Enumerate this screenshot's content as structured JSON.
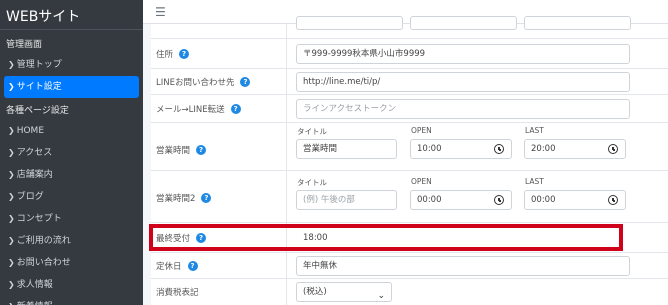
{
  "sidebar": {
    "brand": "WEBサイト",
    "sections": [
      {
        "header": "管理画面",
        "items": [
          {
            "label": "管理トップ",
            "active": false
          },
          {
            "label": "サイト設定",
            "active": true
          }
        ]
      },
      {
        "header": "各種ページ設定",
        "items": [
          {
            "label": "HOME",
            "active": false
          },
          {
            "label": "アクセス",
            "active": false
          },
          {
            "label": "店舗案内",
            "active": false
          },
          {
            "label": "ブログ",
            "active": false
          },
          {
            "label": "コンセプト",
            "active": false
          },
          {
            "label": "ご利用の流れ",
            "active": false
          },
          {
            "label": "お問い合わせ",
            "active": false
          },
          {
            "label": "求人情報",
            "active": false
          },
          {
            "label": "新着情報",
            "active": false
          }
        ]
      }
    ]
  },
  "topbar": {
    "menu_icon": "hamburger-icon"
  },
  "form": {
    "address": {
      "label": "住所",
      "value": "〒999-9999秋本県小山市9999"
    },
    "line_url": {
      "label": "LINEお問い合わせ先",
      "value": "http://line.me/ti/p/"
    },
    "mail_line": {
      "label": "メール→LINE転送",
      "placeholder": "ラインアクセストークン"
    },
    "hours1": {
      "label": "営業時間",
      "title_label": "タイトル",
      "title_value": "営業時間",
      "open_label": "OPEN",
      "open_value": "10:00",
      "last_label": "LAST",
      "last_value": "20:00"
    },
    "hours2": {
      "label": "営業時間2",
      "title_label": "タイトル",
      "title_placeholder": "(例) 午後の部",
      "open_label": "OPEN",
      "open_value": "00:00",
      "last_label": "LAST",
      "last_value": "00:00"
    },
    "last_order": {
      "label": "最終受付",
      "value": "18:00"
    },
    "holiday": {
      "label": "定休日",
      "value": "年中無休"
    },
    "tax": {
      "label": "消費税表記",
      "selected": "(税込)"
    }
  },
  "colors": {
    "sidebar_bg": "#343a40",
    "active": "#007bff",
    "help": "#1e88e5",
    "highlight": "#d0021b"
  }
}
